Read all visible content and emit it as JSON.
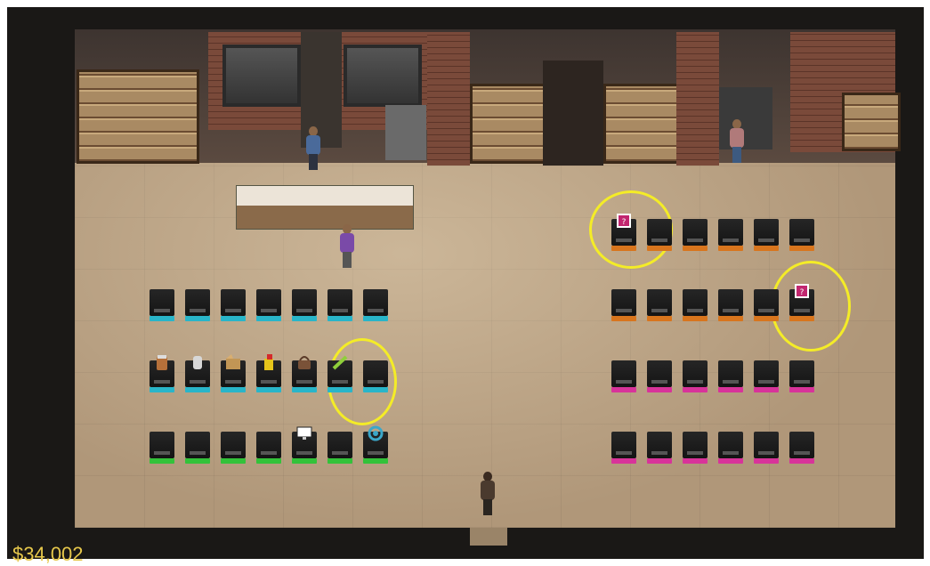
{
  "hud": {
    "money": "$34,002"
  },
  "colors": {
    "highlight": "#f4ec27",
    "money_text": "#e7c84b",
    "teal_strip": "#29b5c9",
    "green_strip": "#33c23a",
    "orange_strip": "#d8751d",
    "magenta_strip": "#d8339a"
  },
  "stations": {
    "left_rows": [
      {
        "color": "teal",
        "count": 7,
        "items": []
      },
      {
        "color": "teal",
        "count": 7,
        "items": [
          "jar-icon",
          "can-icon",
          "cardboard-box-icon",
          "spray-bottle-icon",
          "basket-icon",
          "paint-tube-icon",
          "empty"
        ]
      },
      {
        "color": "green",
        "count": 7,
        "items": [
          "empty",
          "empty",
          "empty",
          "empty",
          "monitor-icon",
          "empty",
          "refresh-icon"
        ]
      }
    ],
    "right_rows": [
      {
        "color": "orange",
        "count": 6,
        "items": [
          "mystery-box-icon",
          "empty",
          "empty",
          "empty",
          "empty",
          "empty"
        ]
      },
      {
        "color": "orange",
        "count": 6,
        "items": [
          "empty",
          "empty",
          "empty",
          "empty",
          "empty",
          "mystery-box-icon"
        ]
      },
      {
        "color": "magenta",
        "count": 6,
        "items": []
      },
      {
        "color": "magenta",
        "count": 6,
        "items": []
      }
    ]
  }
}
